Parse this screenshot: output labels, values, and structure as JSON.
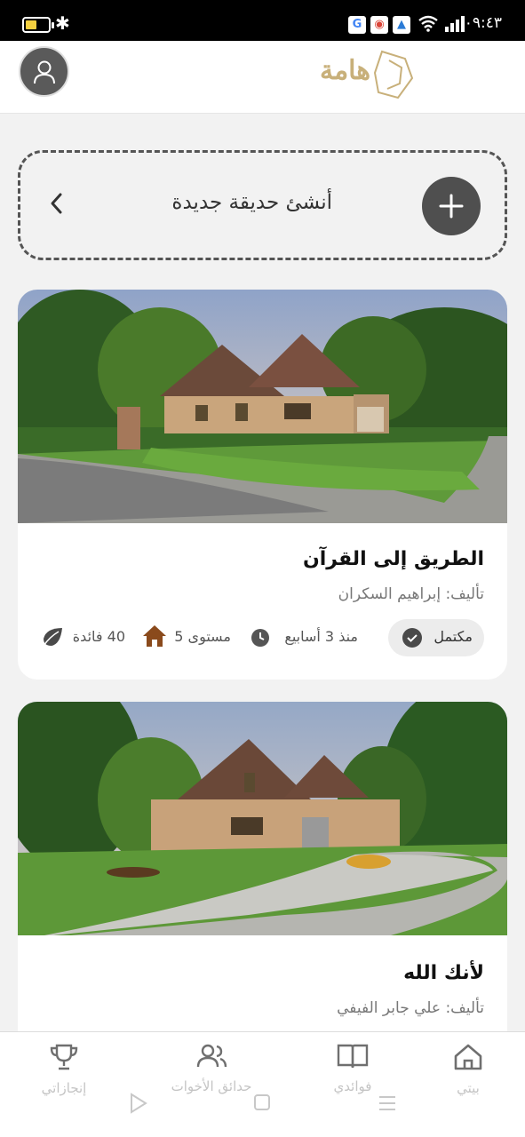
{
  "status_bar": {
    "time": "٠٩:٤٣",
    "battery_level": 0.5
  },
  "header": {
    "logo_text": "هامة"
  },
  "create_garden": {
    "label": "أنشئ حديقة جديدة"
  },
  "gardens": [
    {
      "title": "الطريق إلى القرآن",
      "author": "تأليف: إبراهيم السكران",
      "status": "مكتمل",
      "time_ago": "منذ 3 أسابيع",
      "level": "مستوى 5",
      "benefits": "40 فائدة"
    },
    {
      "title": "لأنك الله",
      "author": "تأليف: علي جابر الفيفي"
    }
  ],
  "bottom_nav": {
    "home": "بيتي",
    "my_benefits": "فوائدي",
    "sisters_gardens": "حدائق الأخوات",
    "achievements": "إنجازاتي"
  },
  "colors": {
    "accent": "#4f4f4f",
    "logo": "#c8b07a",
    "house": "#8a4a1c"
  }
}
